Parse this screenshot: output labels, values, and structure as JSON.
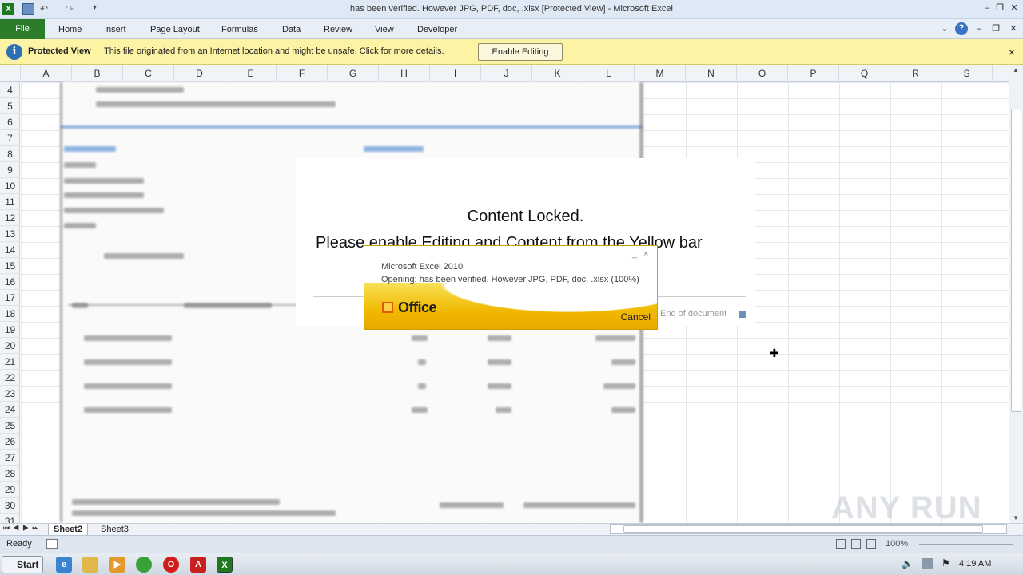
{
  "window": {
    "title": "has been verified. However JPG, PDF, doc, .xlsx  [Protected View] - Microsoft Excel"
  },
  "ribbon": {
    "file": "File",
    "tabs": [
      "Home",
      "Insert",
      "Page Layout",
      "Formulas",
      "Data",
      "Review",
      "View",
      "Developer"
    ]
  },
  "protected_view": {
    "title": "Protected View",
    "message": "This file originated from an Internet location and might be unsafe. Click for more details.",
    "button": "Enable Editing",
    "close": "×"
  },
  "grid": {
    "columns": [
      "A",
      "B",
      "C",
      "D",
      "E",
      "F",
      "G",
      "H",
      "I",
      "J",
      "K",
      "L",
      "M",
      "N",
      "O",
      "P",
      "Q",
      "R",
      "S"
    ],
    "rows": [
      "4",
      "5",
      "6",
      "7",
      "8",
      "9",
      "10",
      "11",
      "12",
      "13",
      "14",
      "15",
      "16",
      "17",
      "18",
      "19",
      "20",
      "21",
      "22",
      "23",
      "24",
      "25",
      "26",
      "27",
      "28",
      "29",
      "30",
      "31"
    ]
  },
  "overlay": {
    "line1": "Content Locked.",
    "line2": "Please enable Editing and Content from the Yellow bar",
    "end_of_document": "End of document"
  },
  "splash": {
    "product": "Microsoft Excel 2010",
    "status": "Opening: has been verified. However JPG, PDF, doc, .xlsx (100%)",
    "logo": "Office",
    "cancel": "Cancel",
    "minimize": "_",
    "close": "×"
  },
  "sheets": [
    "Sheet2",
    "Sheet3"
  ],
  "status": {
    "ready": "Ready",
    "zoom": "100%"
  },
  "taskbar": {
    "start": "Start",
    "clock": "4:19 AM"
  },
  "watermark": "ANY RUN",
  "colors": {
    "file_tab": "#2b7d2b",
    "protected_bar": "#fcf3a4",
    "office_yellow": "#f1b900"
  }
}
